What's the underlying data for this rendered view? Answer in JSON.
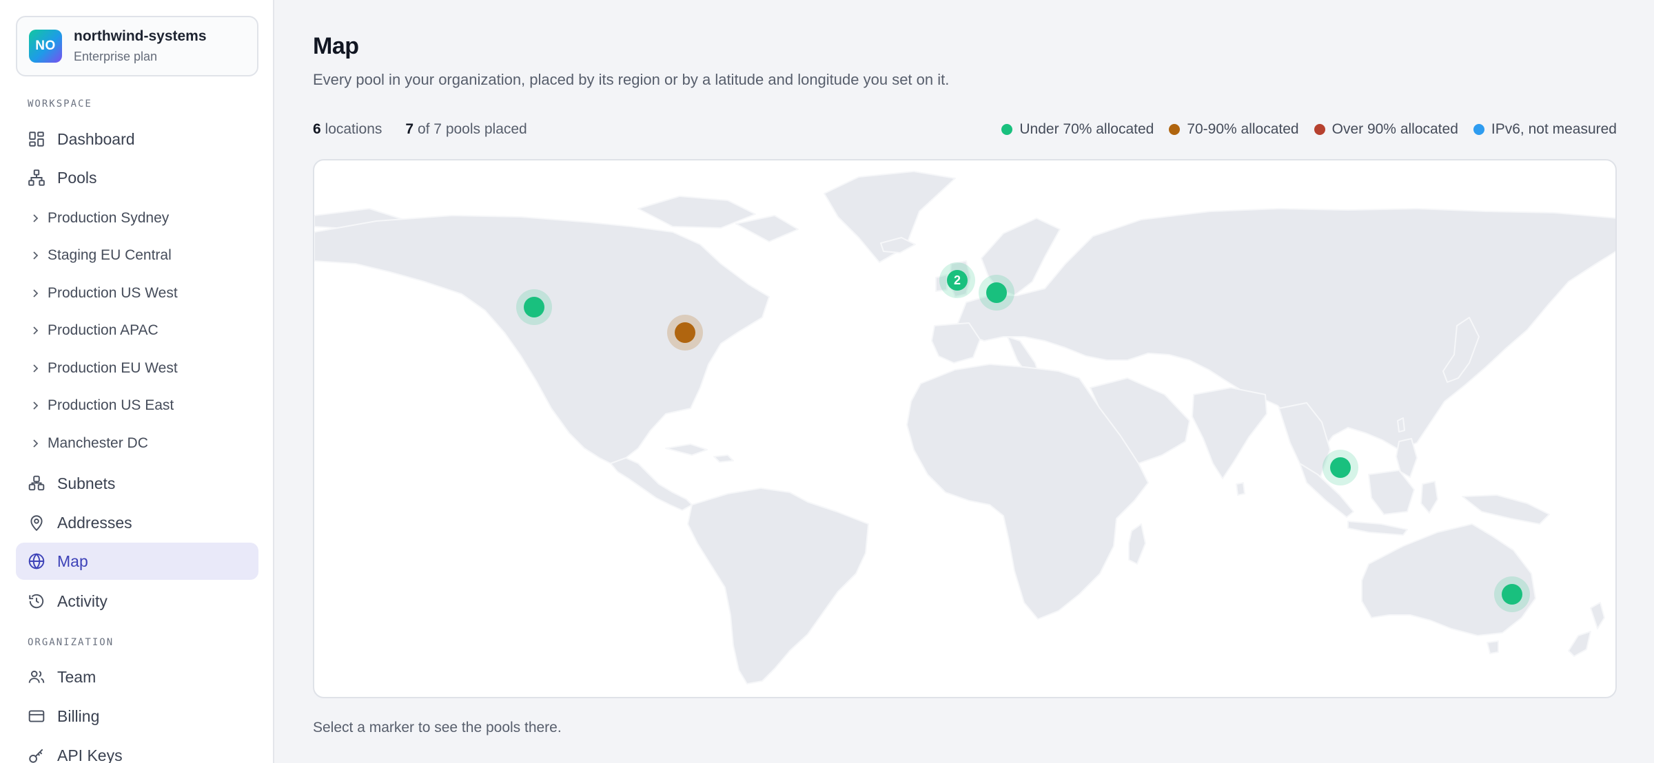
{
  "org": {
    "avatar_initials": "NO",
    "name": "northwind-systems",
    "plan": "Enterprise plan"
  },
  "sidebar": {
    "workspace_label": "WORKSPACE",
    "organization_label": "ORGANIZATION",
    "nav": {
      "dashboard": "Dashboard",
      "pools": "Pools",
      "subnets": "Subnets",
      "addresses": "Addresses",
      "map": "Map",
      "activity": "Activity",
      "team": "Team",
      "billing": "Billing",
      "api_keys": "API Keys"
    },
    "pools": [
      "Production Sydney",
      "Staging EU Central",
      "Production US West",
      "Production APAC",
      "Production EU West",
      "Production US East",
      "Manchester DC"
    ],
    "active_item": "Map"
  },
  "page": {
    "title": "Map",
    "subtitle": "Every pool in your organization, placed by its region or by a latitude and longitude you set on it.",
    "stats": {
      "locations_count": "6",
      "locations_label": "locations",
      "placed_count": "7",
      "placed_label": "of 7 pools placed"
    },
    "legend": [
      {
        "label": "Under 70% allocated",
        "color": "#19c07e"
      },
      {
        "label": "70-90% allocated",
        "color": "#b0650f"
      },
      {
        "label": "Over 90% allocated",
        "color": "#b6412f"
      },
      {
        "label": "IPv6, not measured",
        "color": "#2e9cf0"
      }
    ],
    "markers": [
      {
        "region": "US West",
        "status": "under",
        "count": ""
      },
      {
        "region": "US East",
        "status": "mid",
        "count": ""
      },
      {
        "region": "UK / EU West",
        "status": "under",
        "count": "2"
      },
      {
        "region": "EU Central",
        "status": "under",
        "count": ""
      },
      {
        "region": "APAC",
        "status": "under",
        "count": ""
      },
      {
        "region": "Sydney",
        "status": "under",
        "count": ""
      }
    ],
    "hint": "Select a marker to see the pools there."
  },
  "colors": {
    "accent": "#3d42b8",
    "active_bg": "#e9e9f9",
    "land": "#e7e9ee",
    "land_border": "#f7f8fa"
  }
}
